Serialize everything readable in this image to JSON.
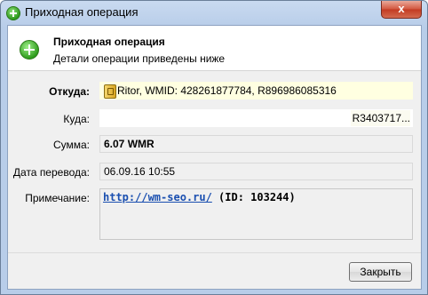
{
  "window": {
    "title": "Приходная операция",
    "close_glyph": "x",
    "icon": "plus-circle-icon"
  },
  "header": {
    "title": "Приходная операция",
    "subtitle": "Детали операции приведены ниже",
    "icon": "plus-circle-icon"
  },
  "form": {
    "from_label": "Откуда:",
    "from_value": "Ritor, WMID: 428261877784, R896986085316",
    "from_icon": "purse-icon",
    "to_label": "Куда:",
    "to_value": "R3403717...",
    "amount_label": "Сумма:",
    "amount_value": "6.07 WMR",
    "date_label": "Дата перевода:",
    "date_value": "06.09.16 10:55",
    "note_label": "Примечание:",
    "note_link": "http://wm-seo.ru/",
    "note_id": " (ID: 103244)"
  },
  "footer": {
    "close_label": "Закрыть"
  },
  "colors": {
    "highlight_field": "#ffffe1",
    "link": "#1a4fb0",
    "close_button": "#c23a22"
  }
}
